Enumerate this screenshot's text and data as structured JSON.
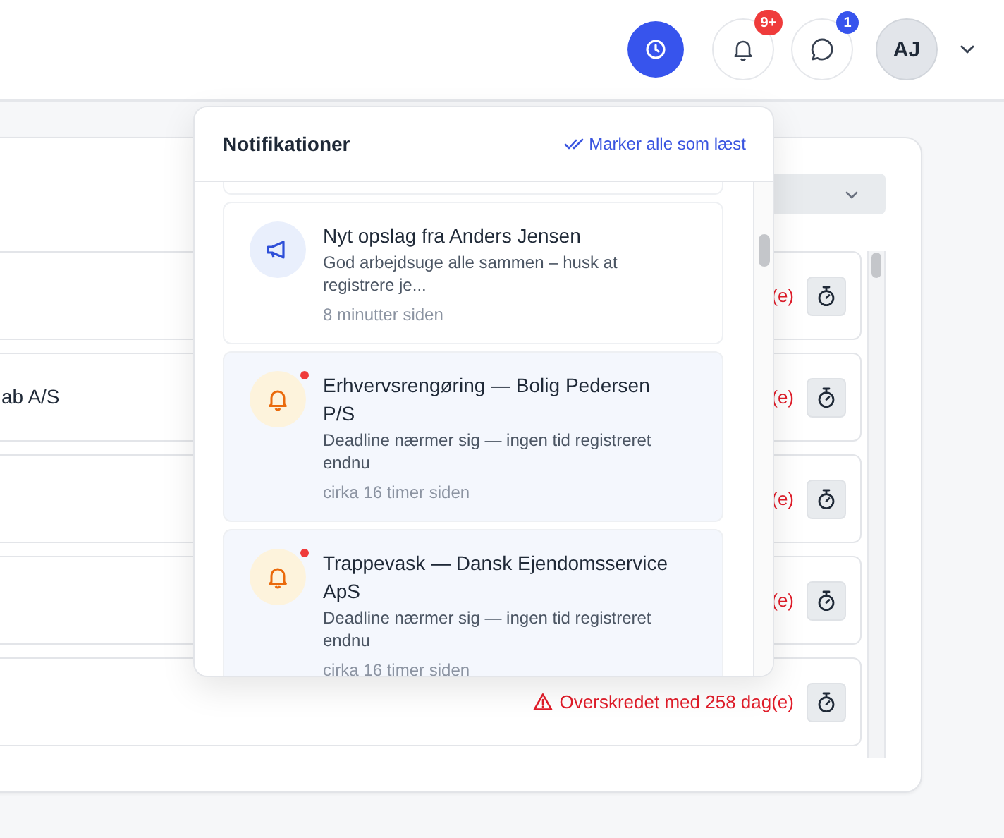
{
  "header": {
    "notifications_badge": "9+",
    "messages_badge": "1",
    "avatar": "AJ"
  },
  "rows": [
    {
      "warning": "(e)",
      "warning_icon": false
    },
    {
      "name": "ab A/S",
      "warning": "(e)",
      "warning_icon": false
    },
    {
      "warning": "(e)",
      "warning_icon": false
    },
    {
      "warning": "(e)",
      "warning_icon": false
    },
    {
      "warning": "Overskredet med 258 dag(e)",
      "warning_icon": true
    }
  ],
  "notifications": {
    "title": "Notifikationer",
    "mark_all": "Marker alle som læst",
    "items": [
      {
        "kind": "post",
        "title": "Nyt opslag fra Anders Jensen",
        "body": "God arbejdsuge alle sammen – husk at registrere je...",
        "time": "8 minutter siden",
        "unread": false
      },
      {
        "kind": "deadline",
        "title": "Erhvervsrengøring — Bolig Pedersen P/S",
        "body": "Deadline nærmer sig — ingen tid registreret endnu",
        "time": "cirka 16 timer siden",
        "unread": true
      },
      {
        "kind": "deadline",
        "title": "Trappevask — Dansk Ejendomsservice ApS",
        "body": "Deadline nærmer sig — ingen tid registreret endnu",
        "time": "cirka 16 timer siden",
        "unread": true
      }
    ]
  }
}
